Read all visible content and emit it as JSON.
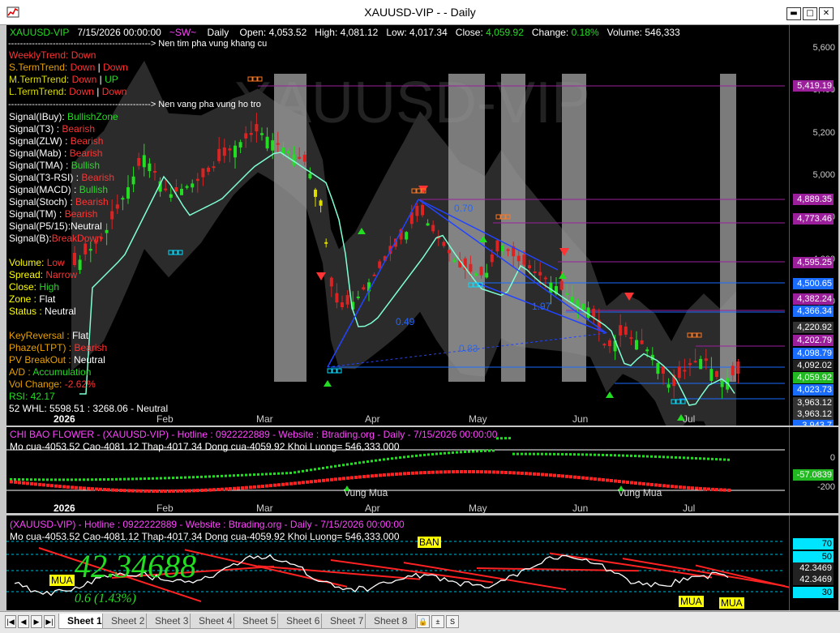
{
  "window": {
    "title": "XAUUSD-VIP -  - Daily",
    "min_glyph": "▬",
    "max_glyph": "□",
    "close_glyph": "✕"
  },
  "main": {
    "header": {
      "symbol": "XAUUSD-VIP",
      "date": "7/15/2026 00:00:00",
      "sw": "~SW~",
      "period": "Daily",
      "open": "Open:  4,053.52",
      "high": "High:  4,081.12",
      "low": "Low:  4,017.34",
      "close_label": "Close:",
      "close": "4,059.92",
      "change_label": "Change:",
      "change": "0.18%",
      "volume": "Volume:  546,333"
    },
    "watermark": "XAUUSD-VIP",
    "notes": {
      "resistance": "------------------------------------------------> Nen tim pha vung khang cu",
      "support": "------------------------------------------------> Nen vang pha vung ho tro"
    },
    "trends": [
      {
        "label": "WeeklyTrend: ",
        "v1": "Down",
        "c1": "#ff3333",
        "v2": "",
        "c2": "#ff3333",
        "lc": "#ff3333"
      },
      {
        "label": "S.TermTrend: ",
        "v1": "Down",
        "c1": "#ff3333",
        "v2": "Down",
        "c2": "#ff3333",
        "lc": "#e8a000"
      },
      {
        "label": "M.TermTrend: ",
        "v1": "Down",
        "c1": "#ff3333",
        "v2": "UP",
        "c2": "#22dd22",
        "lc": "#dddd00"
      },
      {
        "label": "L.TermTrend: ",
        "v1": "Down",
        "c1": "#ff3333",
        "v2": "Down",
        "c2": "#ff3333",
        "lc": "#dddd00"
      }
    ],
    "signals": [
      {
        "label": "Signal(IBuy): ",
        "value": "BullishZone",
        "color": "#22dd22"
      },
      {
        "label": "Signal(T3)   : ",
        "value": "Bearish",
        "color": "#ff3333"
      },
      {
        "label": "Signal(ZLW) : ",
        "value": "Bearish",
        "color": "#ff3333"
      },
      {
        "label": "Signal(Mab)  : ",
        "value": "Bearish",
        "color": "#ff3333"
      },
      {
        "label": "Signal(TMA)  : ",
        "value": "Bullish",
        "color": "#22dd22"
      },
      {
        "label": "Signal(T3-RSI) : ",
        "value": "Bearish",
        "color": "#ff3333"
      },
      {
        "label": "Signal(MACD) : ",
        "value": "Bullish",
        "color": "#22dd22"
      },
      {
        "label": "Signal(Stoch) : ",
        "value": "Bearish",
        "color": "#ff3333"
      },
      {
        "label": "Signal(TM) : ",
        "value": "Bearish",
        "color": "#ff3333"
      },
      {
        "label": "Signal(P5/15):",
        "value": "Neutral",
        "color": "#ffffff"
      },
      {
        "label": "Signal(B):",
        "value": "BreakDown",
        "color": "#ff3333"
      }
    ],
    "volinfo": [
      {
        "label": "Volume: ",
        "value": "Low",
        "lc": "#ffff00",
        "vc": "#ff3333"
      },
      {
        "label": "Spread: ",
        "value": "Narrow",
        "lc": "#ffff00",
        "vc": "#ff3333"
      },
      {
        "label": "Close: ",
        "value": "High",
        "lc": "#ffff00",
        "vc": "#22dd22"
      },
      {
        "label": "Zone : ",
        "value": "Flat",
        "lc": "#ffff00",
        "vc": "#ffffff"
      },
      {
        "label": "Status : ",
        "value": "Neutral",
        "lc": "#ffff00",
        "vc": "#ffffff"
      }
    ],
    "misc": [
      {
        "label": "KeyReversal : ",
        "value": "Flat",
        "lc": "#e8a000",
        "vc": "#ffffff"
      },
      {
        "label": "Phaze(LTPT) : ",
        "value": "Bearish",
        "lc": "#e8a000",
        "vc": "#ff3333"
      },
      {
        "label": "PV BreakOut : ",
        "value": "Neutral",
        "lc": "#e8a000",
        "vc": "#ffffff"
      },
      {
        "label": "A/D : ",
        "value": "Accumulation",
        "lc": "#e8a000",
        "vc": "#22dd22"
      },
      {
        "label": "Vol Change: ",
        "value": "-2.62%",
        "lc": "#e8a000",
        "vc": "#ff3333"
      },
      {
        "label": "RSI: ",
        "value": "42.17",
        "lc": "#22dd22",
        "vc": "#22dd22"
      },
      {
        "label": "52 WHL: ",
        "value": "5598.51 : 3268.06 - Neutral",
        "lc": "#ffffff",
        "vc": "#ffffff"
      }
    ],
    "ticks": [
      "5,600",
      "5,400",
      "5,200",
      "5,000",
      "4,800",
      "4,600",
      "4,400"
    ],
    "price_labels": [
      {
        "value": "5,419.19",
        "bg": "#9b1f9b"
      },
      {
        "value": "4,889.35",
        "bg": "#9b1f9b"
      },
      {
        "value": "4,773.46",
        "bg": "#9b1f9b"
      },
      {
        "value": "4,595.25",
        "bg": "#9b1f9b"
      },
      {
        "value": "4,500.65",
        "bg": "#1a6cff"
      },
      {
        "value": "4,382.24",
        "bg": "#9b1f9b"
      },
      {
        "value": "4,366.34",
        "bg": "#1a6cff"
      },
      {
        "value": "4,220.92",
        "bg": "#333333"
      },
      {
        "value": "4,202.79",
        "bg": "#9b1f9b"
      },
      {
        "value": "4,098.79",
        "bg": "#1a6cff"
      },
      {
        "value": "4,092.02",
        "bg": "#222222"
      },
      {
        "value": "4,059.92",
        "bg": "#22b822"
      },
      {
        "value": "4,023.73",
        "bg": "#1a6cff"
      },
      {
        "value": "3,963.12",
        "bg": "#333333"
      },
      {
        "value": "3,963.12",
        "bg": "#333333"
      },
      {
        "value": "3,943.7",
        "bg": "#1a6cff"
      }
    ],
    "trendline_labels": [
      "0.70",
      "1.97",
      "0.49",
      "0.83"
    ],
    "months": [
      "2026",
      "Feb",
      "Mar",
      "Apr",
      "May",
      "Jun",
      "Jul"
    ]
  },
  "flower": {
    "title": "CHI BAO FLOWER - (XAUUSD-VIP) - Hotline : 0922222889 - Website : Btrading.org - Daily - 7/15/2026 00:00:00",
    "ohlc": "Mo cua-4053.52  Cao-4081.12  Thap-4017.34  Dong cua-4059.92  Khoi Luong= 546,333.000",
    "ticks": [
      "0",
      "-200"
    ],
    "value": "-57.0839",
    "zones": [
      "Vung Mua",
      "Vung Mua"
    ],
    "months": [
      "2026",
      "Feb",
      "Mar",
      "Apr",
      "May",
      "Jun",
      "Jul"
    ]
  },
  "osc": {
    "title": "(XAUUSD-VIP) - Hotline : 0922222889 - Website : Btrading.org - Daily - 7/15/2026 00:00:00",
    "ohlc": "Mo cua-4053.52  Cao-4081.12  Thap-4017.34  Dong cua-4059.92  Khoi Luong= 546,333.000",
    "big_value": "42.34688",
    "change": "0.6 (1.43%)",
    "buy": "MUA",
    "sell": "BAN",
    "scale": [
      {
        "value": "70",
        "bg": "#00e5ff"
      },
      {
        "value": "50",
        "bg": "#00e5ff"
      },
      {
        "value": "42.3469",
        "bg": "#222222"
      },
      {
        "value": "42.3469",
        "bg": "#222222"
      },
      {
        "value": "30",
        "bg": "#00e5ff"
      }
    ]
  },
  "tabs": [
    "Sheet 1",
    "Sheet 2",
    "Sheet 3",
    "Sheet 4",
    "Sheet 5",
    "Sheet 6",
    "Sheet 7",
    "Sheet 8"
  ],
  "colors": {
    "bg": "#000000",
    "bullish": "#22dd22",
    "bearish": "#ff3333",
    "band": "#2a2a2a",
    "ma": "#7fffd4"
  }
}
